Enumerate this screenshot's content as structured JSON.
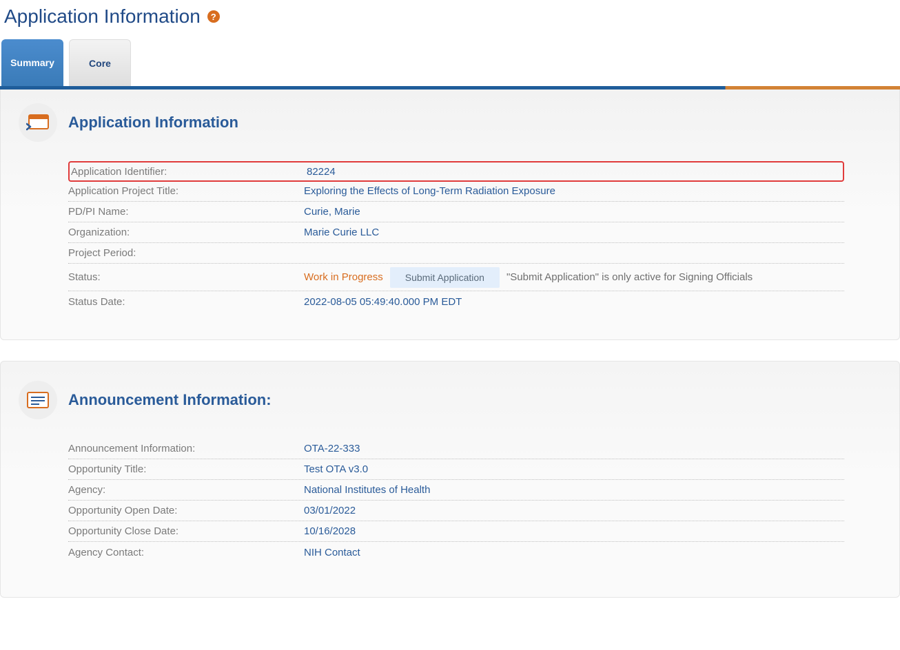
{
  "header": {
    "title": "Application Information",
    "help_glyph": "?"
  },
  "tabs": {
    "summary": "Summary",
    "core": "Core"
  },
  "app_section": {
    "title": "Application Information",
    "rows": {
      "app_id_label": "Application Identifier:",
      "app_id_value": "82224",
      "proj_title_label": "Application Project Title:",
      "proj_title_value": "Exploring the Effects of Long-Term Radiation Exposure",
      "pi_label": "PD/PI Name:",
      "pi_value": "Curie, Marie",
      "org_label": "Organization:",
      "org_value": "Marie Curie LLC",
      "period_label": "Project Period:",
      "period_value": "",
      "status_label": "Status:",
      "status_value": "Work in Progress",
      "submit_btn": "Submit Application",
      "submit_hint": "\"Submit Application\" is only active for Signing Officials",
      "status_date_label": "Status Date:",
      "status_date_value": "2022-08-05 05:49:40.000 PM EDT"
    }
  },
  "ann_section": {
    "title": "Announcement Information:",
    "rows": {
      "ann_info_label": "Announcement Information:",
      "ann_info_value": "OTA-22-333",
      "opp_title_label": "Opportunity Title:",
      "opp_title_value": "Test OTA v3.0",
      "agency_label": "Agency:",
      "agency_value": "National Institutes of Health",
      "open_label": "Opportunity Open Date:",
      "open_value": "03/01/2022",
      "close_label": "Opportunity Close Date:",
      "close_value": "10/16/2028",
      "contact_label": "Agency Contact:",
      "contact_value": "NIH Contact"
    }
  }
}
